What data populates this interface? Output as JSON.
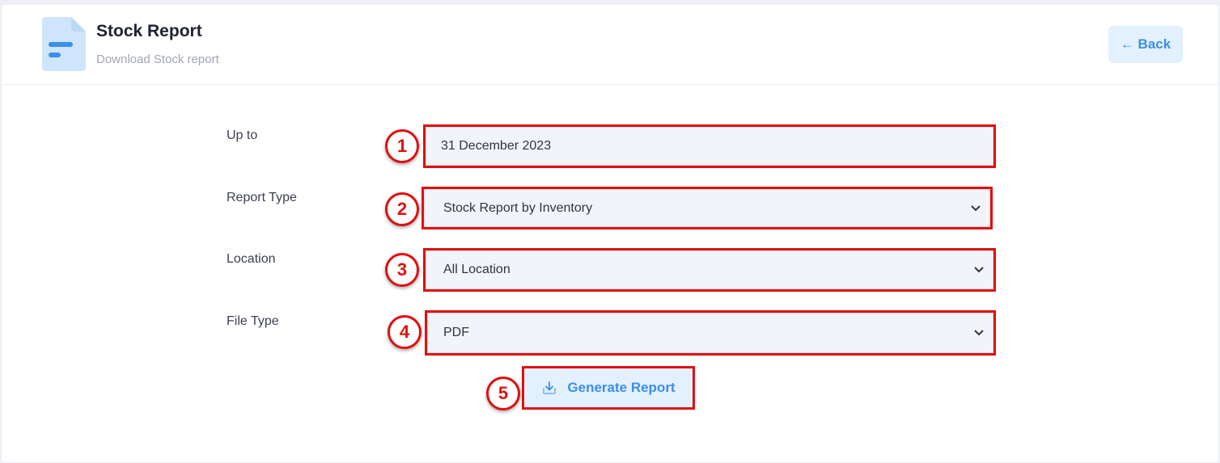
{
  "header": {
    "icon": "document-icon",
    "title": "Stock Report",
    "subtitle": "Download Stock report",
    "back_label": "← Back"
  },
  "form": {
    "up_to": {
      "label": "Up to",
      "value": "31 December 2023",
      "badge": "1"
    },
    "report_type": {
      "label": "Report Type",
      "value": "Stock Report by Inventory",
      "badge": "2"
    },
    "location": {
      "label": "Location",
      "value": "All Location",
      "badge": "3"
    },
    "file_type": {
      "label": "File Type",
      "value": "PDF",
      "badge": "4"
    }
  },
  "generate": {
    "label": "Generate Report",
    "icon": "download-icon",
    "badge": "5"
  },
  "colors": {
    "accent": "#3b8fe8",
    "highlight": "#e01010",
    "button_bg": "#e3f0fd"
  }
}
